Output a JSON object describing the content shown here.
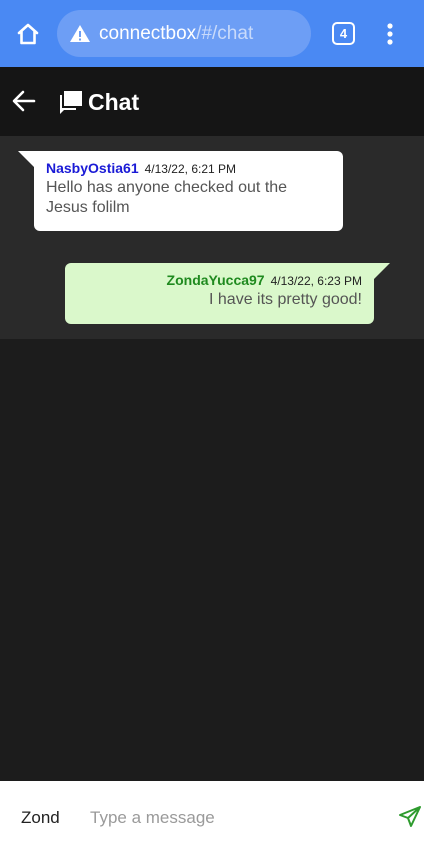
{
  "browser": {
    "url_host": "connectbox",
    "url_path": "/#/chat",
    "tab_count": "4"
  },
  "header": {
    "title": "Chat"
  },
  "messages": [
    {
      "sender": "NasbyOstia61",
      "timestamp": "4/13/22, 6:21 PM",
      "text": "Hello has anyone checked out the Jesus folilm",
      "direction": "incoming"
    },
    {
      "sender": "ZondaYucca97",
      "timestamp": "4/13/22, 6:23 PM",
      "text": "I have its pretty good!",
      "direction": "outgoing"
    }
  ],
  "composer": {
    "user_label": "Zond",
    "placeholder": "Type a message"
  },
  "colors": {
    "browser_bar": "#4a89f3",
    "incoming_sender": "#1a1ad6",
    "outgoing_sender": "#1f8a1f",
    "outgoing_bubble": "#daf8cb",
    "send_icon": "#2e9b2e"
  },
  "icons": {
    "home": "home-icon",
    "warning": "warning-icon",
    "menu": "more-vert-icon",
    "back": "arrow-back-icon",
    "chat": "chat-icon",
    "send": "send-icon"
  }
}
